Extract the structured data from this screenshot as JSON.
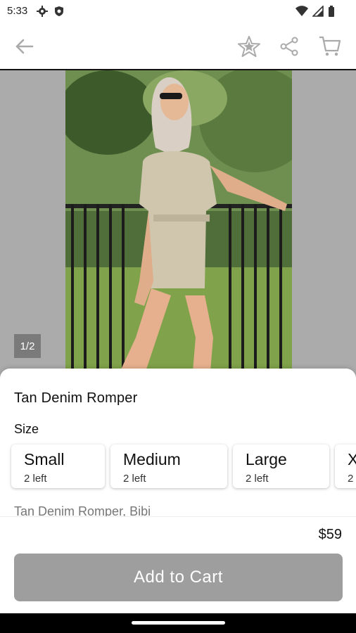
{
  "status_bar": {
    "time": "5:33"
  },
  "header": {},
  "gallery": {
    "page_indicator": "1/2"
  },
  "product": {
    "title": "Tan Denim Romper",
    "size_label": "Size",
    "sizes": [
      {
        "name": "Small",
        "stock": "2 left"
      },
      {
        "name": "Medium",
        "stock": "2 left"
      },
      {
        "name": "Large",
        "stock": "2 left"
      },
      {
        "name": "X",
        "stock": "2"
      }
    ],
    "description": "Tan Denim Romper, Bibi",
    "price": "$59",
    "add_to_cart_label": "Add to Cart"
  },
  "colors": {
    "button_disabled": "#9e9e9e",
    "image_bg": "#ababab"
  }
}
